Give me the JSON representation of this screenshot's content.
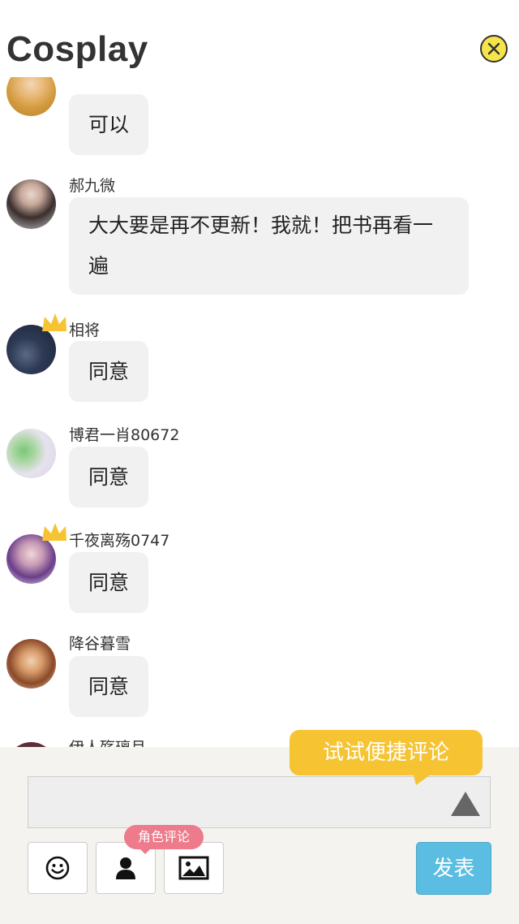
{
  "header": {
    "title": "Cosplay",
    "close_icon": "close-icon",
    "accent": "#f7e34a"
  },
  "messages": [
    {
      "user": "",
      "text": "可以",
      "crown": false
    },
    {
      "user": "郝九微",
      "text": "大大要是再不更新！我就！把书再看一遍",
      "crown": false
    },
    {
      "user": "相将",
      "text": "同意",
      "crown": true
    },
    {
      "user": "博君一肖80672",
      "text": "同意",
      "crown": false
    },
    {
      "user": "千夜离殇0747",
      "text": "同意",
      "crown": true
    },
    {
      "user": "降谷暮雪",
      "text": "同意",
      "crown": false
    },
    {
      "user": "伊人殇璃月",
      "text": "",
      "crown": false
    }
  ],
  "composer": {
    "tip": "试试便捷评论",
    "input_value": "",
    "role_tag": "角色评论",
    "post_label": "发表",
    "tools": [
      "emoji-icon",
      "person-icon",
      "image-icon"
    ],
    "send_icon": "triangle-up-icon"
  },
  "colors": {
    "tip": "#f6c433",
    "role_tag": "#ee7b8b",
    "post_button": "#5bbde1",
    "bubble": "#f1f1f1",
    "crown": "#f6c433"
  }
}
